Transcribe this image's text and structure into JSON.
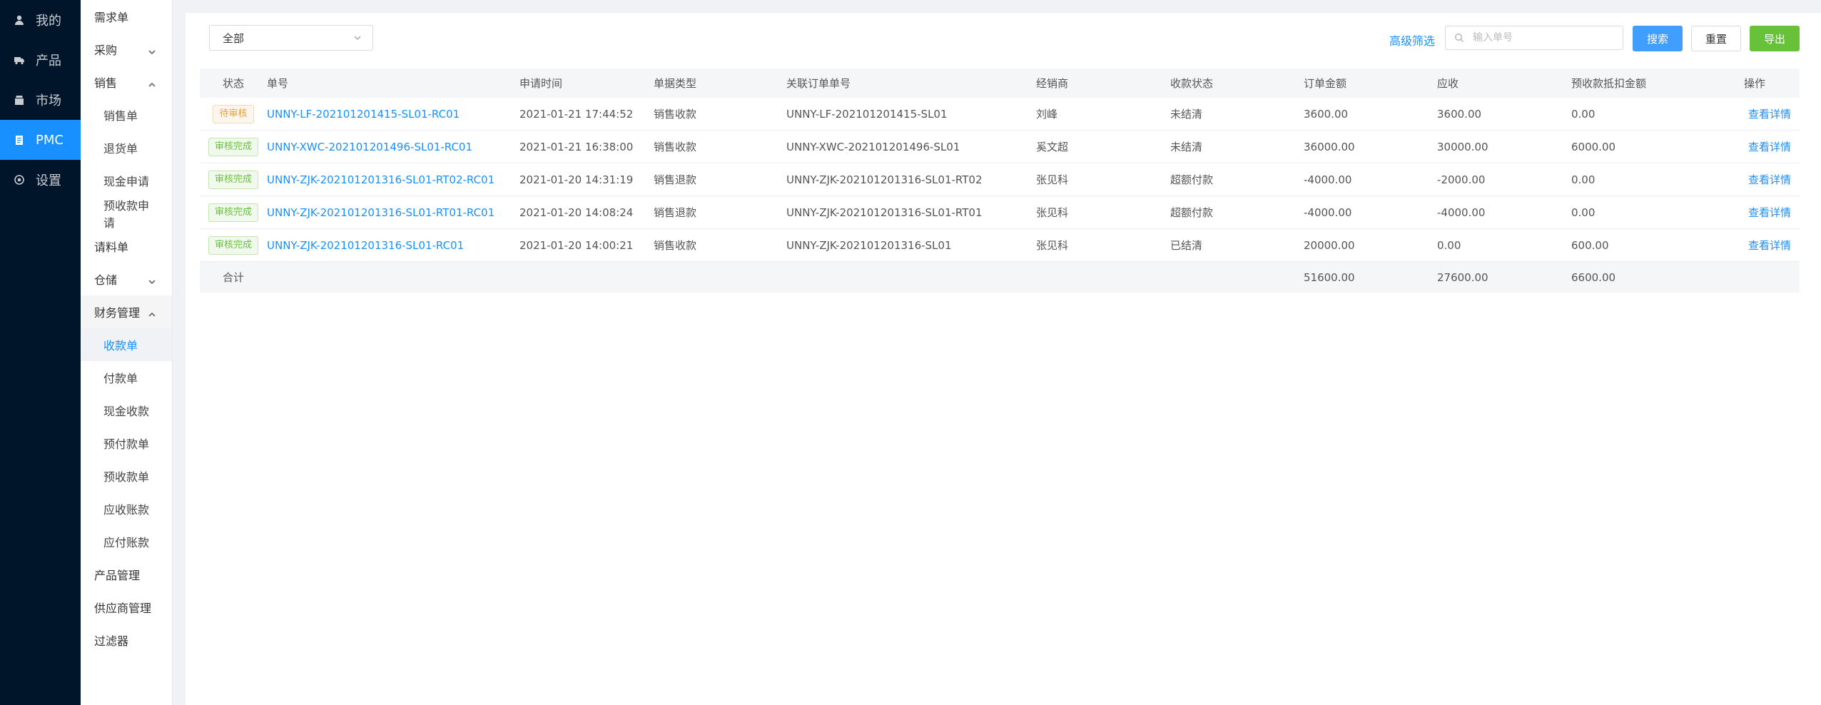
{
  "rail": [
    {
      "icon": "user-icon",
      "label": "我的"
    },
    {
      "icon": "truck-icon",
      "label": "产品"
    },
    {
      "icon": "shop-icon",
      "label": "市场"
    },
    {
      "icon": "clipboard-icon",
      "label": "PMC"
    },
    {
      "icon": "gear-icon",
      "label": "设置"
    }
  ],
  "submenu": {
    "items": [
      {
        "label": "需求单"
      },
      {
        "label": "采购"
      },
      {
        "label": "销售"
      },
      {
        "label": "销售单"
      },
      {
        "label": "退货单"
      },
      {
        "label": "现金申请"
      },
      {
        "label": "预收款申请"
      },
      {
        "label": "请料单"
      },
      {
        "label": "仓储"
      },
      {
        "label": "财务管理"
      },
      {
        "label": "收款单"
      },
      {
        "label": "付款单"
      },
      {
        "label": "现金收款"
      },
      {
        "label": "预付款单"
      },
      {
        "label": "预收款单"
      },
      {
        "label": "应收账款"
      },
      {
        "label": "应付账款"
      },
      {
        "label": "产品管理"
      },
      {
        "label": "供应商管理"
      },
      {
        "label": "过滤器"
      }
    ]
  },
  "toolbar": {
    "select_value": "全部",
    "advanced_filter": "高级筛选",
    "search_placeholder": "输入单号",
    "search_button": "搜索",
    "reset_button": "重置",
    "export_button": "导出"
  },
  "table": {
    "headers": {
      "status": "状态",
      "no": "单号",
      "time": "申请时间",
      "type": "单据类型",
      "related": "关联订单单号",
      "dealer": "经销商",
      "receipt_status": "收款状态",
      "order_amount": "订单金额",
      "receivable": "应收",
      "prepay_offset": "预收款抵扣金额",
      "action": "操作"
    },
    "rows": [
      {
        "status": "待审核",
        "no": "UNNY-LF-202101201415-SL01-RC01",
        "time": "2021-01-21 17:44:52",
        "type": "销售收款",
        "related": "UNNY-LF-202101201415-SL01",
        "dealer": "刘峰",
        "receipt_status": "未结清",
        "order_amount": "3600.00",
        "receivable": "3600.00",
        "prepay_offset": "0.00",
        "action": "查看详情"
      },
      {
        "status": "审核完成",
        "no": "UNNY-XWC-202101201496-SL01-RC01",
        "time": "2021-01-21 16:38:00",
        "type": "销售收款",
        "related": "UNNY-XWC-202101201496-SL01",
        "dealer": "奚文超",
        "receipt_status": "未结清",
        "order_amount": "36000.00",
        "receivable": "30000.00",
        "prepay_offset": "6000.00",
        "action": "查看详情"
      },
      {
        "status": "审核完成",
        "no": "UNNY-ZJK-202101201316-SL01-RT02-RC01",
        "time": "2021-01-20 14:31:19",
        "type": "销售退款",
        "related": "UNNY-ZJK-202101201316-SL01-RT02",
        "dealer": "张见科",
        "receipt_status": "超额付款",
        "order_amount": "-4000.00",
        "receivable": "-2000.00",
        "prepay_offset": "0.00",
        "action": "查看详情"
      },
      {
        "status": "审核完成",
        "no": "UNNY-ZJK-202101201316-SL01-RT01-RC01",
        "time": "2021-01-20 14:08:24",
        "type": "销售退款",
        "related": "UNNY-ZJK-202101201316-SL01-RT01",
        "dealer": "张见科",
        "receipt_status": "超额付款",
        "order_amount": "-4000.00",
        "receivable": "-4000.00",
        "prepay_offset": "0.00",
        "action": "查看详情"
      },
      {
        "status": "审核完成",
        "no": "UNNY-ZJK-202101201316-SL01-RC01",
        "time": "2021-01-20 14:00:21",
        "type": "销售收款",
        "related": "UNNY-ZJK-202101201316-SL01",
        "dealer": "张见科",
        "receipt_status": "已结清",
        "order_amount": "20000.00",
        "receivable": "0.00",
        "prepay_offset": "600.00",
        "action": "查看详情"
      }
    ],
    "summary": {
      "label": "合计",
      "order_amount": "51600.00",
      "receivable": "27600.00",
      "prepay_offset": "6600.00"
    }
  },
  "colors": {
    "rail_bg": "#001529",
    "accent": "#1890ff",
    "export": "#67c23a",
    "pending": "#e6a23c",
    "done": "#67c23a"
  }
}
